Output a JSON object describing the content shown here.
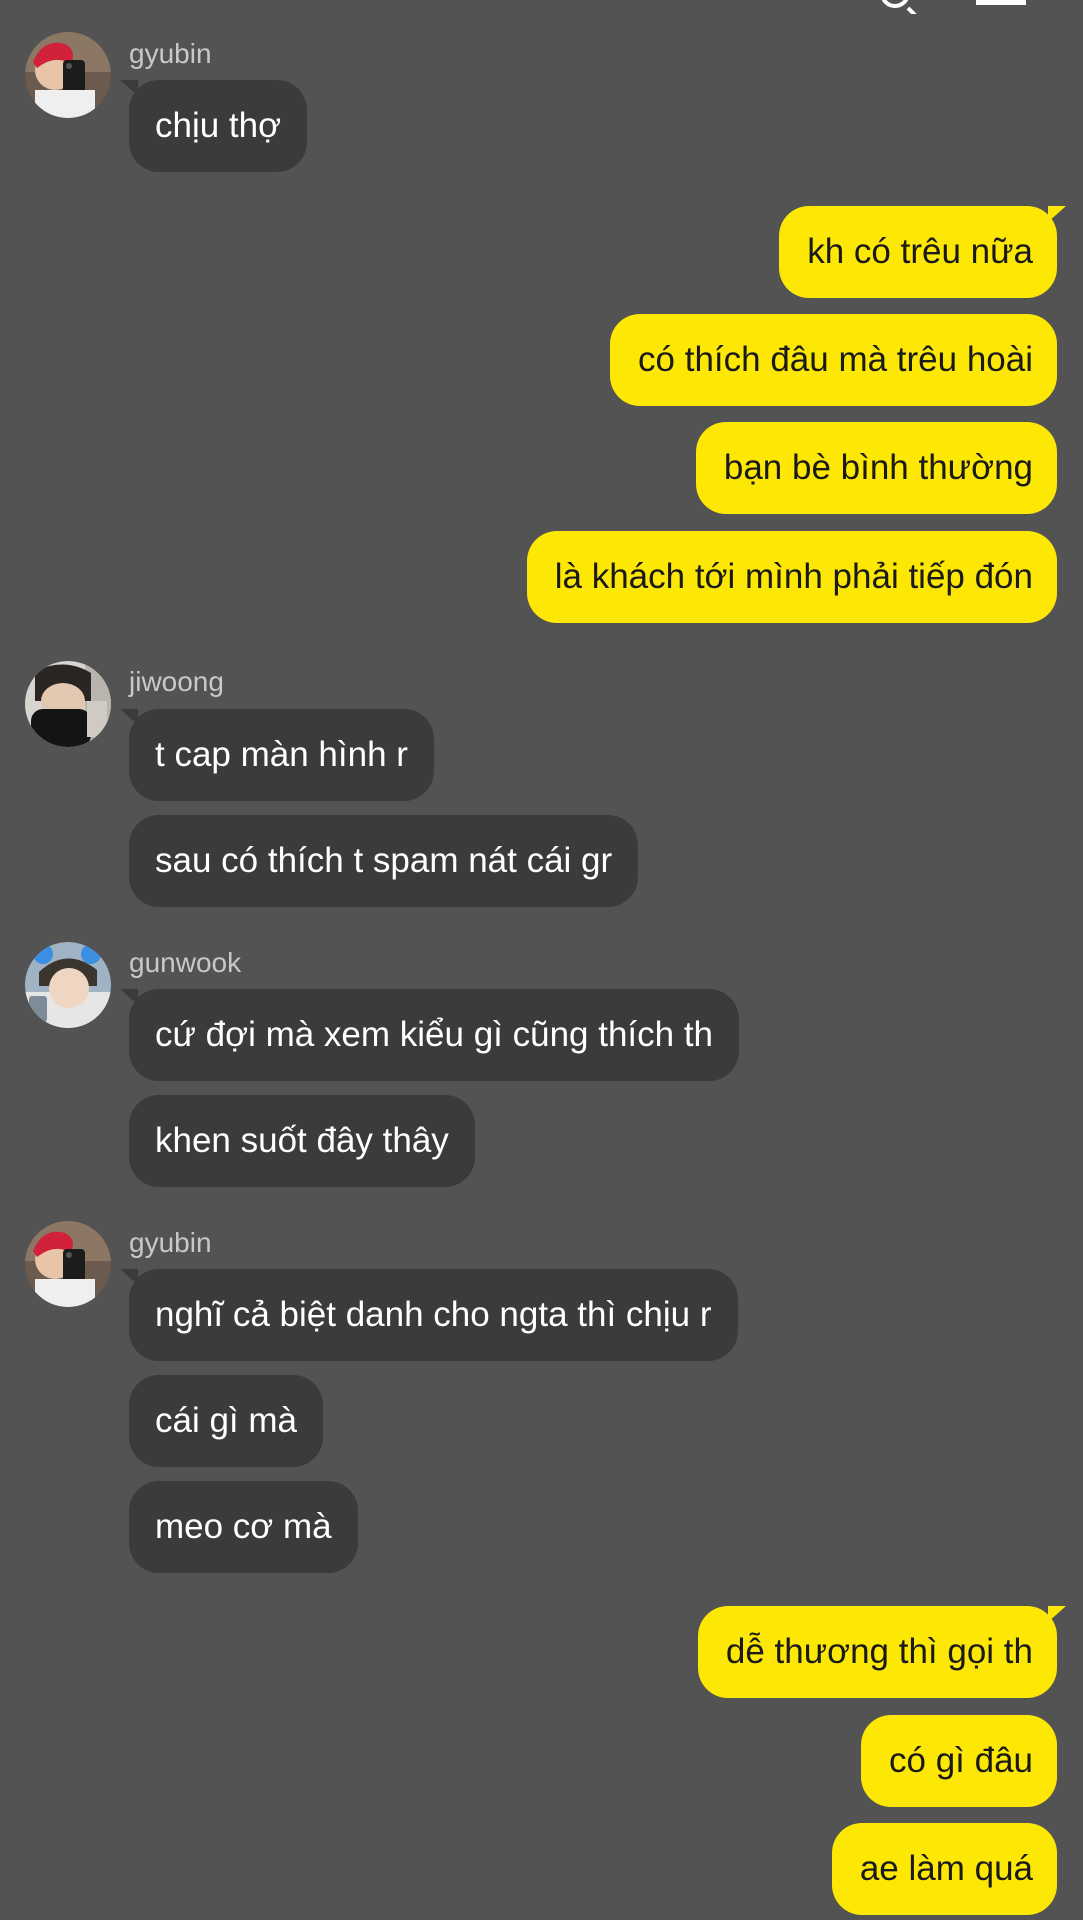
{
  "header": {
    "icons": [
      "search-icon",
      "menu-icon"
    ]
  },
  "colors": {
    "background": "#535354",
    "incoming_bubble": "#3b3b3c",
    "outgoing_bubble": "#fde705",
    "outgoing_text": "#1a1a1a",
    "sender_name": "#c8c8c8"
  },
  "messages": {
    "group1": {
      "sender": "gyubin",
      "m1": "chịu thợ"
    },
    "mine1": {
      "m1": "kh có trêu nữa",
      "m2": "có thích đâu mà trêu hoài",
      "m3": "bạn bè bình thường",
      "m4": "là khách tới mình phải tiếp đón"
    },
    "group2": {
      "sender": "jiwoong",
      "m1": "t cap màn hình r",
      "m2": "sau có thích t spam nát cái gr"
    },
    "group3": {
      "sender": "gunwook",
      "m1": "cứ đợi mà xem kiểu gì cũng thích th",
      "m2": "khen suốt đây thây"
    },
    "group4": {
      "sender": "gyubin",
      "m1": "nghĩ cả biệt danh cho ngta thì chịu r",
      "m2": "cái gì mà",
      "m3": "meo cơ mà"
    },
    "mine2": {
      "m1": "dễ thương thì gọi th",
      "m2": "có gì đâu",
      "m3": "ae làm quá"
    }
  }
}
